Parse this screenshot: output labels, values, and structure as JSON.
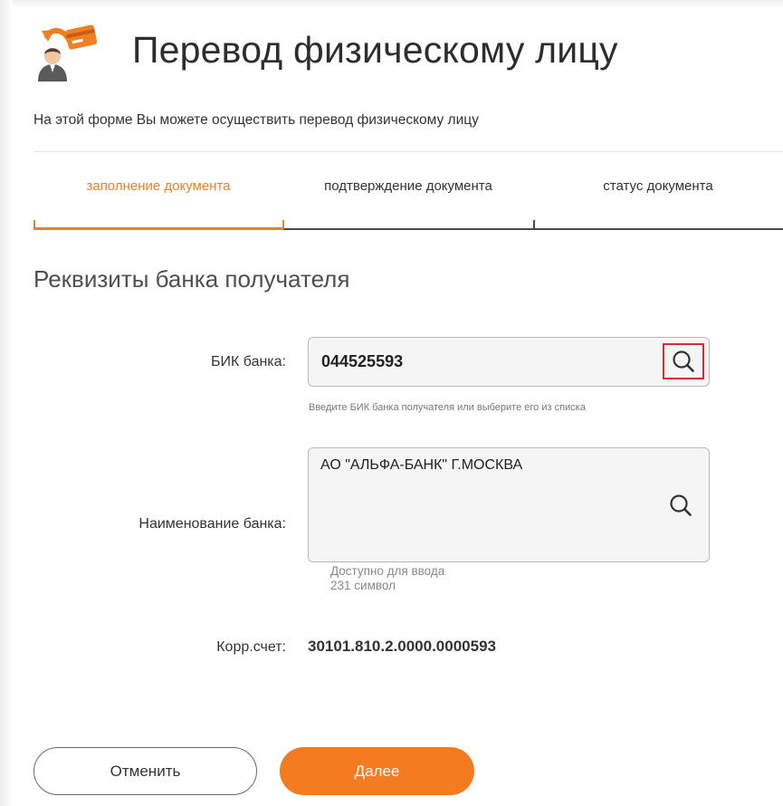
{
  "header": {
    "title": "Перевод физическому лицу",
    "subtitle": "На этой форме Вы можете осуществить перевод физическому лицу",
    "icon": "person-transfer-icon"
  },
  "steps": [
    {
      "label": "заполнение документа",
      "active": true
    },
    {
      "label": "подтверждение документа",
      "active": false
    },
    {
      "label": "статус документа",
      "active": false
    }
  ],
  "section": {
    "title": "Реквизиты банка получателя"
  },
  "form": {
    "bik_label": "БИК банка:",
    "bik_value": "044525593",
    "bik_hint": "Введите БИК банка получателя или выберите его из списка",
    "bank_name_label": "Наименование банка:",
    "bank_name_value": "АО \"АЛЬФА-БАНК\" Г.МОСКВА",
    "counter_line1": "Доступно для ввода",
    "counter_line2": "231 символ",
    "corr_label": "Корр.счет:",
    "corr_value": "30101.810.2.0000.0000593"
  },
  "buttons": {
    "cancel": "Отменить",
    "next": "Далее"
  },
  "colors": {
    "accent": "#ef7f22",
    "highlight": "#d32f2f"
  }
}
